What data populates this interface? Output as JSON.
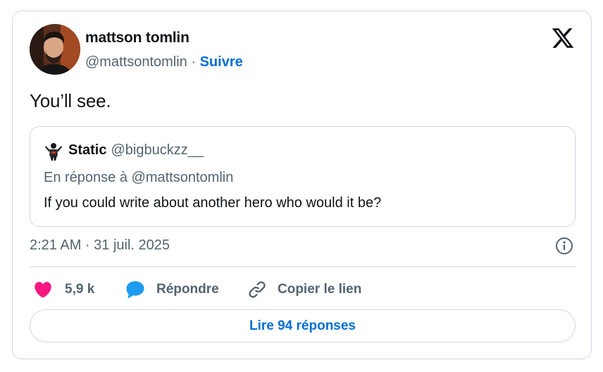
{
  "tweet": {
    "author": {
      "name": "mattson tomlin",
      "handle": "@mattsontomlin",
      "separator": "·",
      "follow_label": "Suivre",
      "avatar_icon": "profile-photo"
    },
    "platform_icon": "x-logo-icon",
    "text": "You’ll see.",
    "quoted": {
      "name": "Static",
      "handle": "@bigbuckzz__",
      "reply_context": "En réponse à @mattsontomlin",
      "text": "If you could write about another hero who would it be?"
    },
    "timestamp": "2:21 AM · 31 juil. 2025",
    "actions": {
      "like_count": "5,9 k",
      "reply_label": "Répondre",
      "copy_label": "Copier le lien"
    },
    "read_replies_label": "Lire 94 réponses"
  },
  "colors": {
    "accent": "#006fd6",
    "heart": "#f91880",
    "reply_bubble": "#1d9bf0",
    "secondary_text": "#536471",
    "border": "#cfd9de"
  }
}
